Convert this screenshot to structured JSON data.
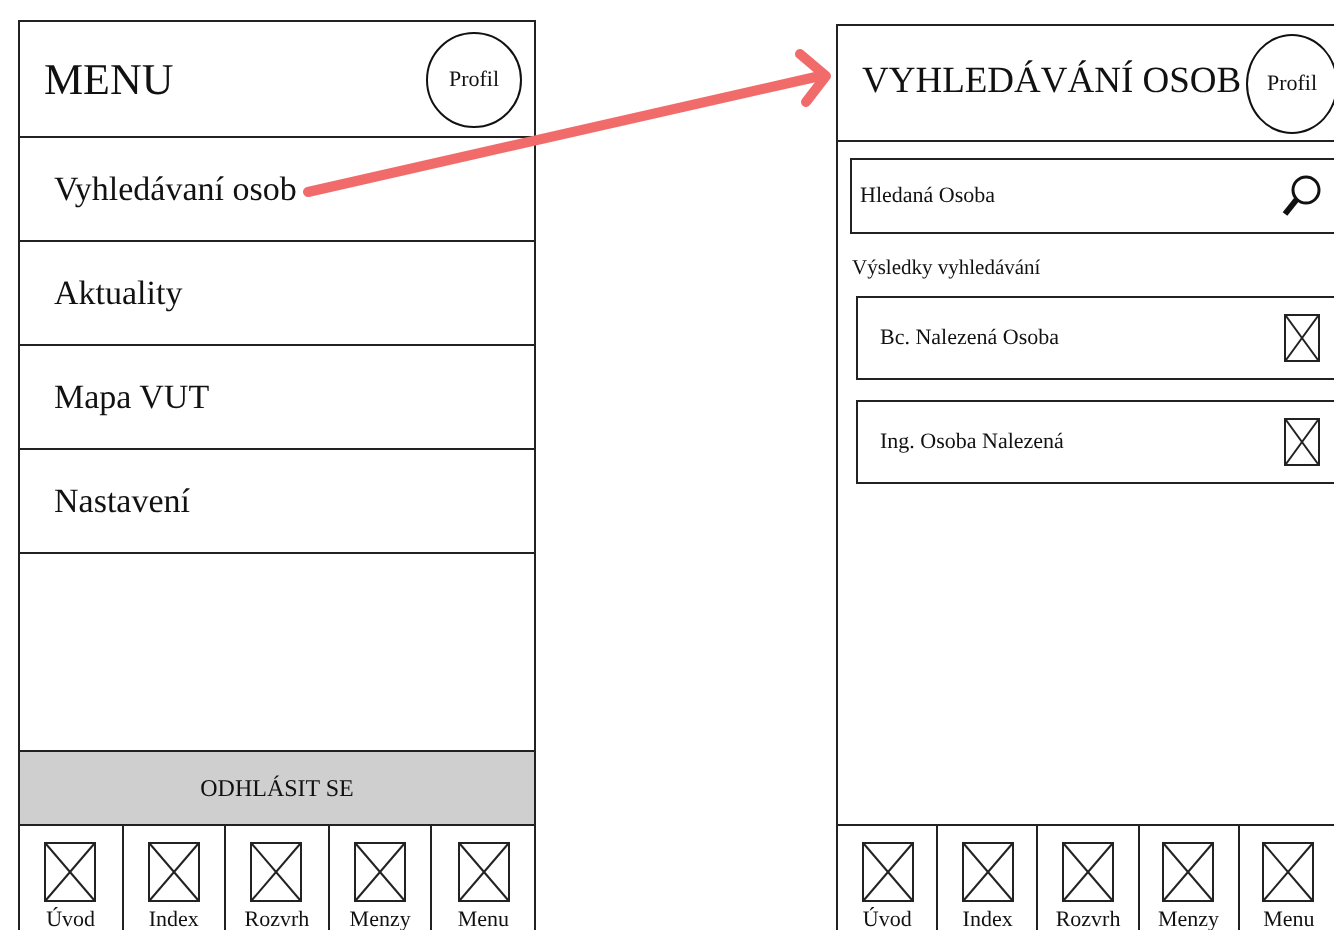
{
  "screens": [
    {
      "title": "MENU",
      "profile": "Profil",
      "menu_items": [
        "Vyhledávaní osob",
        "Aktuality",
        "Mapa VUT",
        "Nastavení"
      ],
      "logout": "ODHLÁSIT SE",
      "tabs": [
        "Úvod",
        "Index",
        "Rozvrh",
        "Menzy",
        "Menu"
      ]
    },
    {
      "title": "VYHLEDÁVÁNÍ OSOB",
      "profile": "Profil",
      "search": {
        "value": "Hledaná Osoba"
      },
      "results_label": "Výsledky vyhledávání",
      "results": [
        "Bc. Nalezená Osoba",
        "Ing. Osoba Nalezená"
      ],
      "tabs": [
        "Úvod",
        "Index",
        "Rozvrh",
        "Menzy",
        "Menu"
      ]
    }
  ]
}
